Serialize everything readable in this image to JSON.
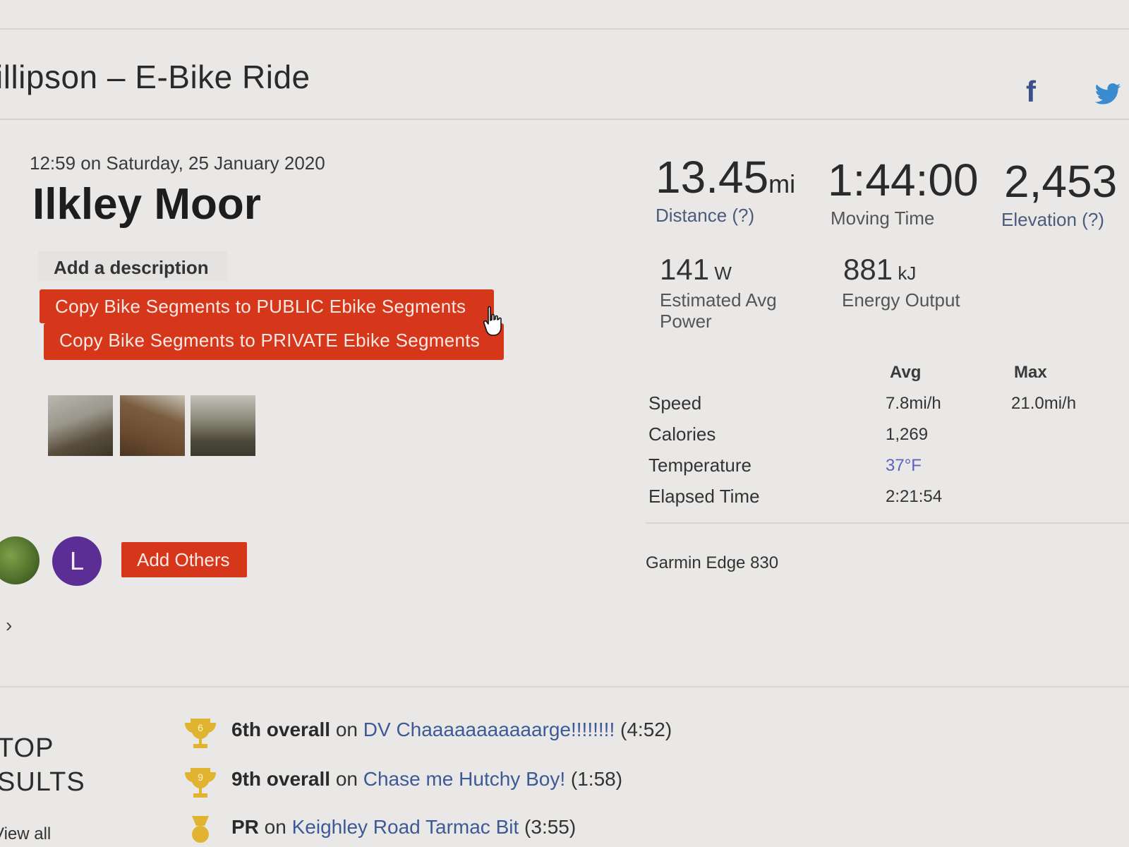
{
  "header": {
    "title": "illipson – E-Bike Ride",
    "share_facebook": "f"
  },
  "activity": {
    "datetime": "12:59 on Saturday, 25 January 2020",
    "name": "Ilkley Moor",
    "add_description": "Add a description",
    "copy_public_button": "Copy Bike Segments to PUBLIC Ebike Segments",
    "copy_private_button": "Copy Bike Segments to PRIVATE Ebike Segments",
    "photos": [
      "photo-1",
      "photo-2",
      "photo-3"
    ],
    "avatar_letter": "L",
    "add_others_button": "Add Others",
    "expand_chevron": "›"
  },
  "stats": {
    "distance": {
      "value": "13.45",
      "unit": "mi",
      "label": "Distance (?)"
    },
    "moving_time": {
      "value": "1:44:00",
      "label": "Moving Time"
    },
    "elevation": {
      "value": "2,453",
      "label": "Elevation (?)"
    },
    "power": {
      "value": "141",
      "unit": "W",
      "label_line1": "Estimated Avg",
      "label_line2": "Power"
    },
    "energy": {
      "value": "881",
      "unit": "kJ",
      "label": "Energy Output"
    }
  },
  "details": {
    "col_avg": "Avg",
    "col_max": "Max",
    "rows": [
      {
        "label": "Speed",
        "avg": "7.8mi/h",
        "max": "21.0mi/h"
      },
      {
        "label": "Calories",
        "avg": "1,269",
        "max": ""
      },
      {
        "label": "Temperature",
        "avg": "37°F",
        "max": ""
      },
      {
        "label": "Elapsed Time",
        "avg": "2:21:54",
        "max": ""
      }
    ],
    "device": "Garmin Edge 830"
  },
  "top_results": {
    "heading_line1": "TOP",
    "heading_line2": "SULTS",
    "view_all": "View all",
    "items": [
      {
        "rank": "6th overall",
        "on": " on ",
        "segment": "DV Chaaaaaaaaaaarge!!!!!!!!",
        "time": " (4:52)",
        "trophy_number": "6"
      },
      {
        "rank": "9th overall",
        "on": " on ",
        "segment": "Chase me Hutchy Boy!",
        "time": " (1:58)",
        "trophy_number": "9"
      },
      {
        "rank": "PR",
        "on": " on ",
        "segment": "Keighley Road Tarmac Bit",
        "time": " (3:55)",
        "trophy_number": ""
      }
    ]
  },
  "colors": {
    "accent_red": "#d6361a",
    "link_blue": "#3d5a96",
    "avatar_purple": "#5b2e96",
    "trophy_gold": "#e0b430"
  }
}
